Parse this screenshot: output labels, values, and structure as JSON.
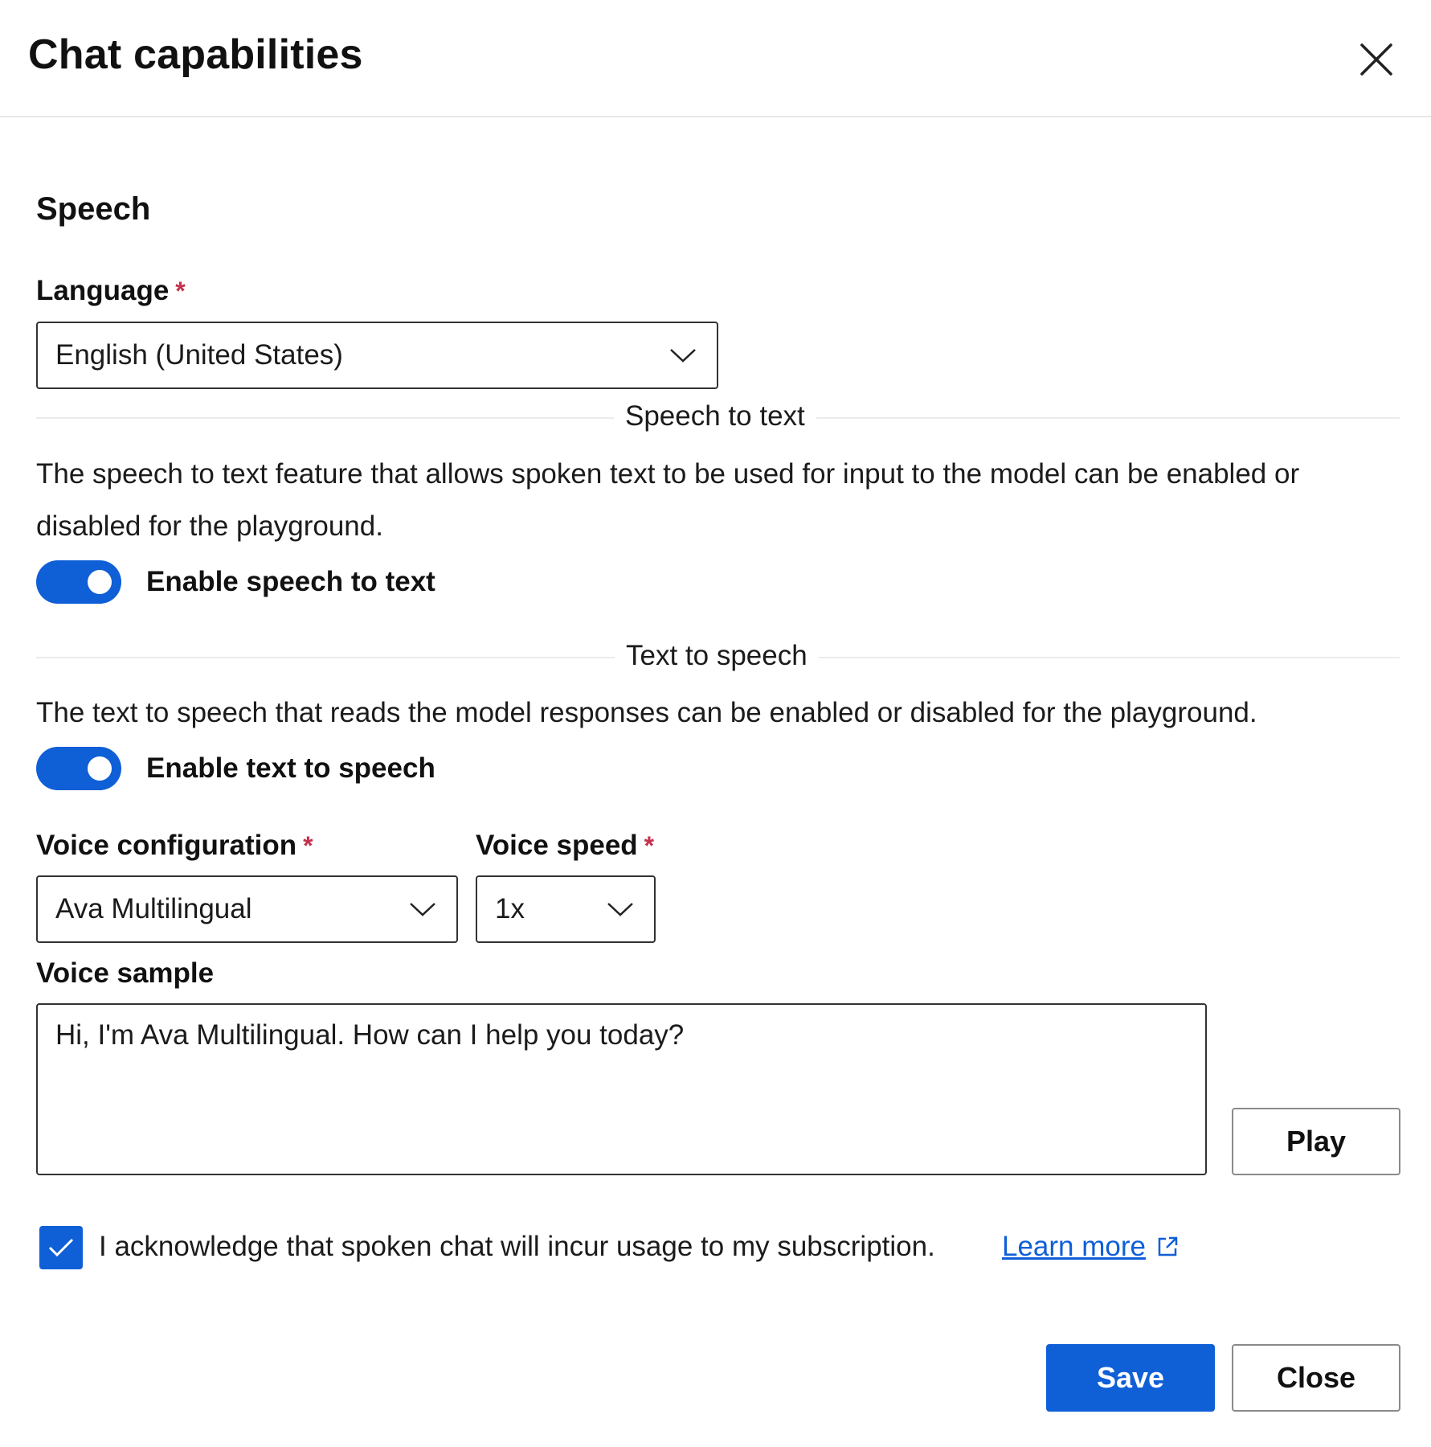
{
  "dialog": {
    "title": "Chat capabilities",
    "close_icon": "close-icon"
  },
  "speech": {
    "section_title": "Speech",
    "language": {
      "label": "Language",
      "required_mark": "*",
      "value": "English (United States)"
    },
    "speech_to_text": {
      "divider_label": "Speech to text",
      "description": "The speech to text feature that allows spoken text to be used for input to the model can be enabled or disabled for the playground.",
      "toggle_label": "Enable speech to text",
      "enabled": true
    },
    "text_to_speech": {
      "divider_label": "Text to speech",
      "description": "The text to speech that reads the model responses can be enabled or disabled for the playground.",
      "toggle_label": "Enable text to speech",
      "enabled": true
    },
    "voice_configuration": {
      "label": "Voice configuration",
      "required_mark": "*",
      "value": "Ava Multilingual"
    },
    "voice_speed": {
      "label": "Voice speed",
      "required_mark": "*",
      "value": "1x"
    },
    "voice_sample": {
      "label": "Voice sample",
      "value": "Hi, I'm Ava Multilingual. How can I help you today?",
      "play_label": "Play"
    },
    "acknowledge": {
      "checked": true,
      "text": "I acknowledge that spoken chat will incur usage to my subscription.",
      "link_text": "Learn more"
    }
  },
  "footer": {
    "save_label": "Save",
    "close_label": "Close"
  },
  "colors": {
    "accent": "#0f5fd7",
    "required": "#c4314b",
    "divider": "#ebebeb",
    "text": "#1b1b1b"
  }
}
